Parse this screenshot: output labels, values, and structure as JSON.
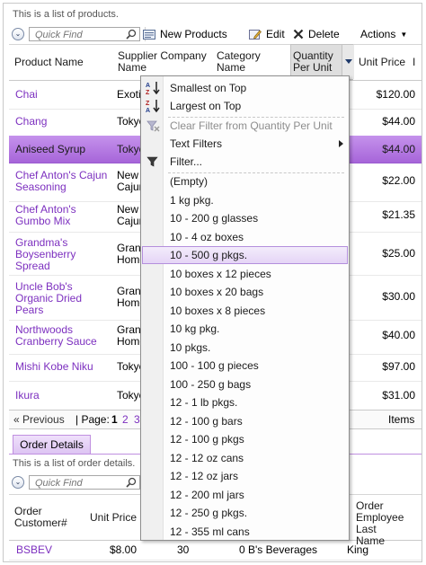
{
  "products": {
    "description": "This is a list of products.",
    "toolbar": {
      "quick_find_placeholder": "Quick Find",
      "new_label": "New Products",
      "edit_label": "Edit",
      "delete_label": "Delete",
      "actions_label": "Actions"
    },
    "columns": {
      "product_name": "Product Name",
      "supplier_line1": "Supplier Company",
      "supplier_line2": "Name",
      "category_line1": "Category",
      "category_line2": "Name",
      "qty_line1": "Quantity",
      "qty_line2": "Per Unit",
      "unit_price": "Unit Price",
      "trailing": "I"
    },
    "rows": [
      {
        "name1": "Chai",
        "name2": "",
        "name3": "",
        "sup1": "Exotic",
        "sup2": "",
        "price": "$120.00"
      },
      {
        "name1": "Chang",
        "name2": "",
        "name3": "",
        "sup1": "Tokyo",
        "sup2": "",
        "price": "$44.00"
      },
      {
        "name1": "Aniseed Syrup",
        "name2": "",
        "name3": "",
        "sup1": "Tokyo",
        "sup2": "",
        "price": "$44.00"
      },
      {
        "name1": "Chef Anton's Cajun",
        "name2": "Seasoning",
        "name3": "",
        "sup1": "New O",
        "sup2": "Cajun",
        "price": "$22.00"
      },
      {
        "name1": "Chef Anton's",
        "name2": "Gumbo Mix",
        "name3": "",
        "sup1": "New O",
        "sup2": "Cajun",
        "price": "$21.35"
      },
      {
        "name1": "Grandma's",
        "name2": "Boysenberry",
        "name3": "Spread",
        "sup1": "Grand",
        "sup2": "Home",
        "price": "$25.00"
      },
      {
        "name1": "Uncle Bob's",
        "name2": "Organic Dried",
        "name3": "Pears",
        "sup1": "Grand",
        "sup2": "Home",
        "price": "$30.00"
      },
      {
        "name1": "Northwoods",
        "name2": "Cranberry Sauce",
        "name3": "",
        "sup1": "Grand",
        "sup2": "Home",
        "price": "$40.00"
      },
      {
        "name1": "Mishi Kobe Niku",
        "name2": "",
        "name3": "",
        "sup1": "Tokyo",
        "sup2": "",
        "price": "$97.00"
      },
      {
        "name1": "Ikura",
        "name2": "",
        "name3": "",
        "sup1": "Tokyo",
        "sup2": "",
        "price": "$31.00"
      }
    ],
    "pager": {
      "previous": "« Previous",
      "page_label": "| Page:",
      "page1": "1",
      "page2": "2",
      "page3": "3",
      "items": "Items"
    }
  },
  "filter_menu": {
    "smallest_on_top": "Smallest on Top",
    "largest_on_top": "Largest on Top",
    "clear_filter": "Clear Filter from Quantity Per Unit",
    "text_filters": "Text Filters",
    "filter": "Filter...",
    "values": [
      "(Empty)",
      "1 kg pkg.",
      "10 - 200 g glasses",
      "10 - 4 oz boxes",
      "10 - 500 g pkgs.",
      "10 boxes x 12 pieces",
      "10 boxes x 20 bags",
      "10 boxes x 8 pieces",
      "10 kg pkg.",
      "10 pkgs.",
      "100 - 100 g pieces",
      "100 - 250 g bags",
      "12 - 1 lb pkgs.",
      "12 - 100 g bars",
      "12 - 100 g pkgs",
      "12 - 12 oz cans",
      "12 - 12 oz jars",
      "12 - 200 ml jars",
      "12 - 250 g pkgs.",
      "12 - 355 ml cans"
    ],
    "hovered_index": 4
  },
  "order_details": {
    "tab_label": "Order Details",
    "description": "This is a list of order details.",
    "quick_find_placeholder": "Quick Find",
    "columns": {
      "order_line1": "Order",
      "order_line2": "Customer#",
      "unit_price": "Unit Price",
      "emp_line1": "Order",
      "emp_line2": "Employee Last",
      "emp_line3": "Name"
    },
    "row": {
      "customer": "BSBEV",
      "unit_price": "$8.00",
      "quantity": "30",
      "order_name": "0 B's Beverages",
      "employee": "King"
    }
  },
  "colors": {
    "accent_purple": "#7c2fbf",
    "selected_row": "#b67be2",
    "menu_hover": "#e5d5f6"
  }
}
